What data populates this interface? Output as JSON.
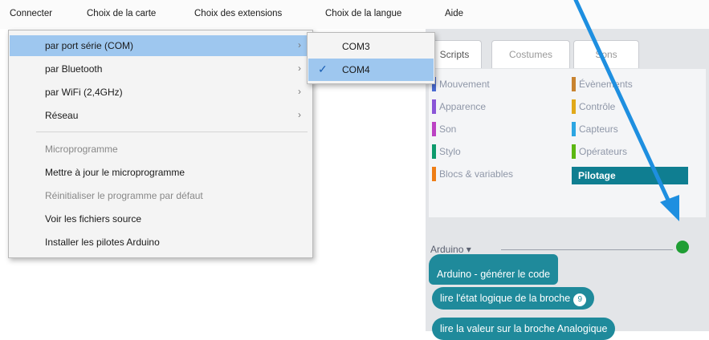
{
  "menubar": {
    "items": [
      "Connecter",
      "Choix de la carte",
      "Choix des extensions",
      "Choix de la langue",
      "Aide"
    ]
  },
  "dropdown": {
    "items": [
      {
        "label": "par port série (COM)",
        "submenu": true,
        "state": "active"
      },
      {
        "label": "par Bluetooth",
        "submenu": true,
        "state": "normal"
      },
      {
        "label": "par WiFi (2,4GHz)",
        "submenu": true,
        "state": "normal"
      },
      {
        "label": "Réseau",
        "submenu": true,
        "state": "normal"
      },
      {
        "label": "Microprogramme",
        "submenu": false,
        "state": "disabled"
      },
      {
        "label": "Mettre à jour le microprogramme",
        "submenu": false,
        "state": "normal"
      },
      {
        "label": "Réinitialiser le programme par défaut",
        "submenu": false,
        "state": "disabled"
      },
      {
        "label": "Voir les fichiers source",
        "submenu": false,
        "state": "normal"
      },
      {
        "label": "Installer les pilotes Arduino",
        "submenu": false,
        "state": "normal"
      }
    ]
  },
  "submenu": {
    "items": [
      {
        "label": "COM3",
        "checked": false
      },
      {
        "label": "COM4",
        "checked": true
      }
    ]
  },
  "tabs": [
    "Scripts",
    "Costumes",
    "Sons"
  ],
  "categories": {
    "left": [
      {
        "label": "Mouvement",
        "color": "#4a6cd4"
      },
      {
        "label": "Apparence",
        "color": "#8a55d7"
      },
      {
        "label": "Son",
        "color": "#bb42c3"
      },
      {
        "label": "Stylo",
        "color": "#0e9a6c"
      },
      {
        "label": "Blocs & variables",
        "color": "#ee7d16"
      }
    ],
    "right": [
      {
        "label": "Évènements",
        "color": "#c88330"
      },
      {
        "label": "Contrôle",
        "color": "#e1a91a"
      },
      {
        "label": "Capteurs",
        "color": "#2ca5e2"
      },
      {
        "label": "Opérateurs",
        "color": "#5cb712"
      },
      {
        "label": "Pilotage",
        "color": "#0f7e91"
      }
    ]
  },
  "arduino_header": "Arduino ▾",
  "blocks": {
    "generate": "Arduino - générer le code",
    "read_digital": "lire l'état logique de la broche",
    "read_digital_badge": "9",
    "read_analog": "lire la valeur sur la broche Analogique"
  },
  "icons": {
    "submenu_arrow": "chevron-right-icon",
    "check": "checkmark-icon",
    "dropdown_caret": "caret-down-icon",
    "annotation": "annotation-arrow",
    "status_dot": "green-status-dot"
  },
  "colors": {
    "accent_highlight": "#9ec7ef",
    "block_teal": "#1f8a9b",
    "arrow_blue": "#1e8fe0",
    "status_green": "#1f9e34"
  }
}
